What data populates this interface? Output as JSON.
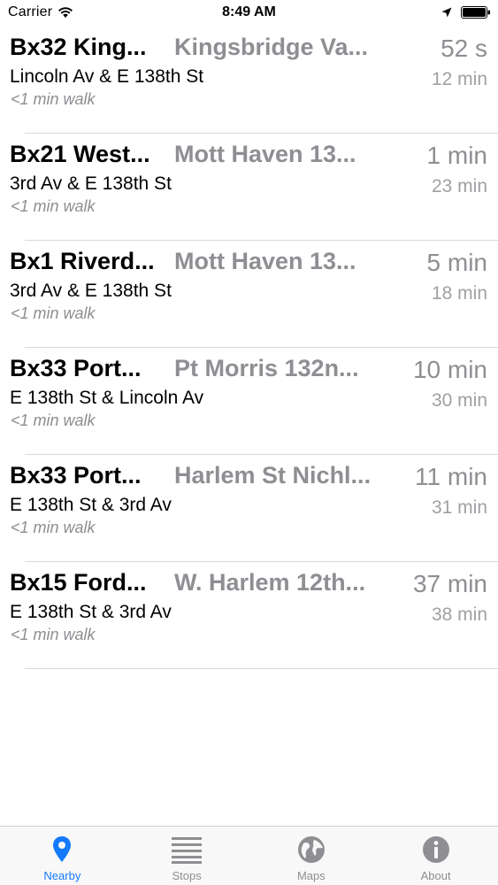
{
  "status_bar": {
    "carrier": "Carrier",
    "time": "8:49 AM",
    "icons": [
      "wifi-icon",
      "location-arrow-icon",
      "battery-icon"
    ]
  },
  "rows": [
    {
      "route": "Bx32 King...",
      "destination": "Kingsbridge Va...",
      "stop": "Lincoln Av & E 138th St",
      "walk": "<1 min walk",
      "eta_primary": "52 s",
      "eta_secondary": "12 min"
    },
    {
      "route": "Bx21 West...",
      "destination": "Mott Haven 13...",
      "stop": "3rd Av & E 138th St",
      "walk": "<1 min walk",
      "eta_primary": "1 min",
      "eta_secondary": "23 min"
    },
    {
      "route": "Bx1 Riverd...",
      "destination": "Mott Haven 13...",
      "stop": "3rd Av & E 138th St",
      "walk": "<1 min walk",
      "eta_primary": "5 min",
      "eta_secondary": "18 min"
    },
    {
      "route": "Bx33 Port...",
      "destination": "Pt Morris 132n...",
      "stop": "E 138th St & Lincoln Av",
      "walk": "<1 min walk",
      "eta_primary": "10 min",
      "eta_secondary": "30 min"
    },
    {
      "route": "Bx33 Port...",
      "destination": "Harlem St Nichl...",
      "stop": "E 138th St & 3rd Av",
      "walk": "<1 min walk",
      "eta_primary": "11 min",
      "eta_secondary": "31 min"
    },
    {
      "route": "Bx15 Ford...",
      "destination": "W. Harlem 12th...",
      "stop": "E 138th St & 3rd Av",
      "walk": "<1 min walk",
      "eta_primary": "37 min",
      "eta_secondary": "38 min"
    }
  ],
  "tab_bar": {
    "active_color": "#1479fb",
    "inactive_color": "#8e8e93",
    "tabs": [
      {
        "label": "Nearby",
        "icon": "location-pin-icon",
        "active": true
      },
      {
        "label": "Stops",
        "icon": "list-icon",
        "active": false
      },
      {
        "label": "Maps",
        "icon": "globe-icon",
        "active": false
      },
      {
        "label": "About",
        "icon": "info-icon",
        "active": false
      }
    ]
  }
}
